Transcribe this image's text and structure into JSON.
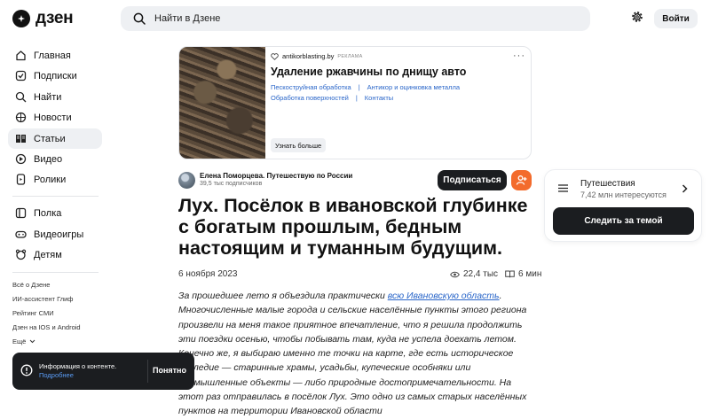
{
  "header": {
    "logo_text": "дзен",
    "search_placeholder": "Найти в Дзене",
    "login_label": "Войти"
  },
  "sidebar": {
    "items": [
      {
        "label": "Главная",
        "icon": "home-icon"
      },
      {
        "label": "Подписки",
        "icon": "subscriptions-icon"
      },
      {
        "label": "Найти",
        "icon": "search-icon"
      },
      {
        "label": "Новости",
        "icon": "news-icon"
      },
      {
        "label": "Статьи",
        "icon": "articles-icon",
        "active": true
      },
      {
        "label": "Видео",
        "icon": "video-icon"
      },
      {
        "label": "Ролики",
        "icon": "shorts-icon"
      },
      {
        "label": "Полка",
        "icon": "shelf-icon"
      },
      {
        "label": "Видеоигры",
        "icon": "gamepad-icon"
      },
      {
        "label": "Детям",
        "icon": "kids-icon"
      }
    ],
    "footer_links": [
      "Всё о Дзене",
      "ИИ-ассистент Глиф",
      "Рейтинг СМИ",
      "Дзен на IOS и Android",
      "Ещё"
    ]
  },
  "ad": {
    "source": "antikorblasting.by",
    "tag": "РЕКЛАМА",
    "title": "Удаление ржавчины по днищу авто",
    "links_row1": [
      "Пескоструйная обработка",
      "Антикор и оцинковка металла"
    ],
    "links_row2": [
      "Обработка поверхностей",
      "Контакты"
    ],
    "button": "Узнать больше"
  },
  "author": {
    "name": "Елена Поморцева. Путешествую по России",
    "subscribers": "39,5 тыс подписчиков",
    "subscribe_label": "Подписаться"
  },
  "article": {
    "title": "Лух. Посёлок в ивановской глубинке с богатым прошлым, бедным настоящим и туманным будущим.",
    "date": "6 ноября 2023",
    "views": "22,4 тыс",
    "read_time": "6 мин",
    "body_start": "За прошедшее лето я объездила практически ",
    "body_link": "всю Ивановскую область",
    "body_rest": ". Многочисленные малые города и сельские населённые пункты этого региона произвели на меня такое приятное впечатление, что я решила продолжить эти поездки осенью, чтобы побывать там, куда не успела доехать летом. Конечно же, я выбираю именно те точки на карте, где есть историческое наследие — старинные храмы, усадьбы, купеческие особняки или промышленные объекты — либо природные достопримечательности. На этот раз отправилась в посёлок Лух. Это одно из самых старых населённых пунктов на территории Ивановской области"
  },
  "topic": {
    "name": "Путешествия",
    "count": "7,42 млн интересуются",
    "follow_label": "Следить за темой"
  },
  "toast": {
    "info": "Информация о контенте.",
    "more": "Подробнее",
    "ok": "Понятно"
  },
  "colors": {
    "accent_orange": "#f36b2c",
    "link_blue": "#2a66c9",
    "dark_button": "#1b1d20"
  }
}
